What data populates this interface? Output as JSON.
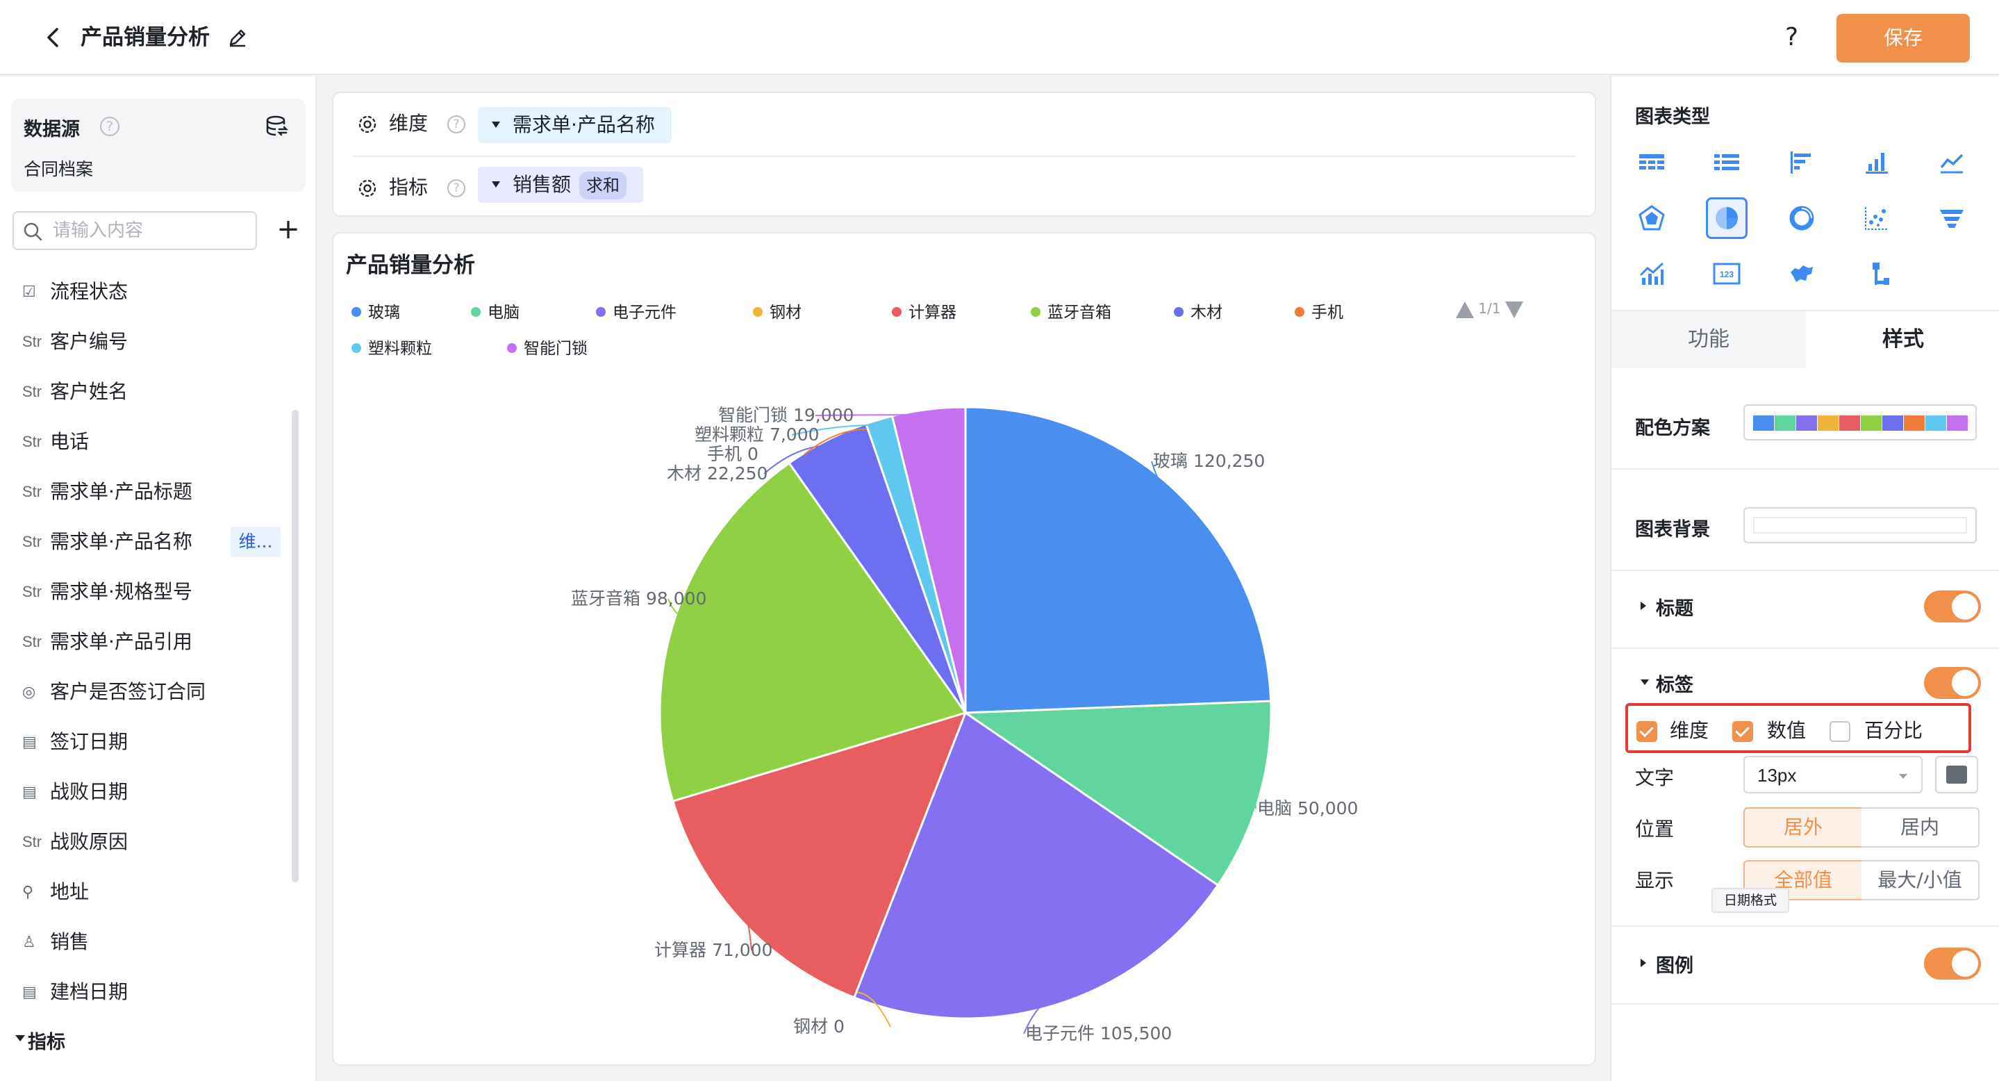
{
  "header": {
    "title": "产品销量分析",
    "help_label": "?",
    "save_label": "保存"
  },
  "left_panel": {
    "datasource_title": "数据源",
    "datasource_name": "合同档案",
    "help_glyph": "?",
    "search_placeholder": "请输入内容",
    "add_label": "+",
    "fields": [
      {
        "type_icon": "checkbox-icon",
        "type_glyph": "☑",
        "label": "流程状态"
      },
      {
        "type_icon": "string-type-icon",
        "type_glyph": "Str",
        "label": "客户编号"
      },
      {
        "type_icon": "string-type-icon",
        "type_glyph": "Str",
        "label": "客户姓名"
      },
      {
        "type_icon": "string-type-icon",
        "type_glyph": "Str",
        "label": "电话"
      },
      {
        "type_icon": "string-type-icon",
        "type_glyph": "Str",
        "label": "需求单·产品标题"
      },
      {
        "type_icon": "string-type-icon",
        "type_glyph": "Str",
        "label": "需求单·产品名称",
        "tag": "维..."
      },
      {
        "type_icon": "string-type-icon",
        "type_glyph": "Str",
        "label": "需求单·规格型号"
      },
      {
        "type_icon": "string-type-icon",
        "type_glyph": "Str",
        "label": "需求单·产品引用"
      },
      {
        "type_icon": "radio-icon",
        "type_glyph": "◎",
        "label": "客户是否签订合同"
      },
      {
        "type_icon": "date-icon",
        "type_glyph": "▤",
        "label": "签订日期"
      },
      {
        "type_icon": "date-icon",
        "type_glyph": "▤",
        "label": "战败日期"
      },
      {
        "type_icon": "string-type-icon",
        "type_glyph": "Str",
        "label": "战败原因"
      },
      {
        "type_icon": "address-icon",
        "type_glyph": "⚲",
        "label": "地址"
      },
      {
        "type_icon": "user-icon",
        "type_glyph": "♙",
        "label": "销售"
      },
      {
        "type_icon": "date-icon",
        "type_glyph": "▤",
        "label": "建档日期"
      }
    ],
    "metrics_section": "指标"
  },
  "config": {
    "dimension_label": "维度",
    "dimension_value": "需求单·产品名称",
    "metric_label": "指标",
    "metric_value": "销售额",
    "metric_agg": "求和",
    "help_glyph": "?"
  },
  "chart_panel": {
    "legend_pager": "1/1"
  },
  "chart_data": {
    "type": "pie",
    "title": "产品销量分析",
    "categories": [
      "玻璃",
      "电脑",
      "电子元件",
      "钢材",
      "计算器",
      "蓝牙音箱",
      "木材",
      "手机",
      "塑料颗粒",
      "智能门锁"
    ],
    "values": [
      120250,
      50000,
      105500,
      0,
      71000,
      98000,
      22250,
      0,
      7000,
      19000
    ],
    "value_labels": [
      "120,250",
      "50,000",
      "105,500",
      "0",
      "71,000",
      "98,000",
      "22,250",
      "0",
      "7,000",
      "19,000"
    ],
    "colors": [
      "#4a8ff0",
      "#62d49f",
      "#8470f0",
      "#f0b43c",
      "#e85e60",
      "#8fd045",
      "#6c70f0",
      "#f07c3c",
      "#5ec8f0",
      "#c471f0"
    ],
    "legend_position": "top",
    "labels_show": [
      "dimension",
      "value"
    ]
  },
  "right_panel": {
    "chart_type_heading": "图表类型",
    "chart_types": [
      {
        "icon": "pivot-table-icon"
      },
      {
        "icon": "detail-table-icon"
      },
      {
        "icon": "bar-chart-icon"
      },
      {
        "icon": "column-chart-icon"
      },
      {
        "icon": "line-chart-icon"
      },
      {
        "icon": "radar-chart-icon"
      },
      {
        "icon": "pie-chart-icon",
        "active": true
      },
      {
        "icon": "donut-chart-icon"
      },
      {
        "icon": "scatter-chart-icon"
      },
      {
        "icon": "funnel-chart-icon"
      },
      {
        "icon": "combo-chart-icon"
      },
      {
        "icon": "kpi-number-icon"
      },
      {
        "icon": "map-chart-icon"
      },
      {
        "icon": "tree-chart-icon"
      }
    ],
    "kpi_glyph": "123",
    "tab_function": "功能",
    "tab_style": "样式",
    "palette_label": "配色方案",
    "background_label": "图表背景",
    "title_section": "标题",
    "label_section": "标签",
    "label_options": [
      {
        "label": "维度",
        "checked": true
      },
      {
        "label": "数值",
        "checked": true
      },
      {
        "label": "百分比",
        "checked": false
      }
    ],
    "text_label": "文字",
    "text_size": "13px",
    "text_color": "#646a73",
    "position_label": "位置",
    "position_outside": "居外",
    "position_inside": "居内",
    "display_label": "显示",
    "display_all": "全部值",
    "display_minmax": "最大/小值",
    "tooltip": "日期格式",
    "legend_section": "图例"
  }
}
